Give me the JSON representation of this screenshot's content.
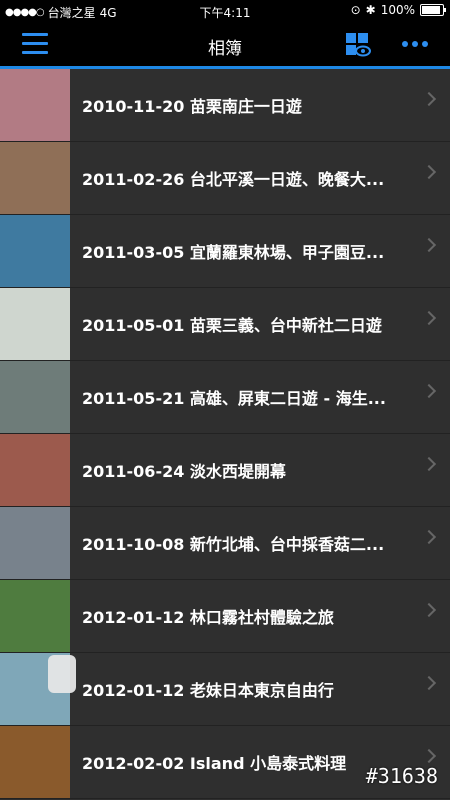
{
  "status": {
    "carrier": "台灣之星",
    "network": "4G",
    "time": "下午4:11",
    "battery": "100%",
    "battery_level": 1.0
  },
  "nav": {
    "title": "相簿"
  },
  "albums": [
    {
      "title": "2010-11-20 苗栗南庄一日遊",
      "thumb_color": "#b27b84"
    },
    {
      "title": "2011-02-26 台北平溪一日遊、晚餐大...",
      "thumb_color": "#8f6f57"
    },
    {
      "title": "2011-03-05 宜蘭羅東林場、甲子園豆...",
      "thumb_color": "#3f7aa0"
    },
    {
      "title": "2011-05-01 苗栗三義、台中新社二日遊",
      "thumb_color": "#cfd6cf"
    },
    {
      "title": "2011-05-21 高雄、屏東二日遊 - 海生...",
      "thumb_color": "#6e7c79"
    },
    {
      "title": "2011-06-24 淡水西堤開幕",
      "thumb_color": "#9c5a4d"
    },
    {
      "title": "2011-10-08 新竹北埔、台中採香菇二...",
      "thumb_color": "#78828c"
    },
    {
      "title": "2012-01-12 林口霧社村體驗之旅",
      "thumb_color": "#4f7c3f"
    },
    {
      "title": "2012-01-12 老妹日本東京自由行",
      "thumb_color": "#7fa7b8"
    },
    {
      "title": "2012-02-02 Island 小島泰式料理",
      "thumb_color": "#8a5a2c"
    }
  ],
  "watermark": "#31638"
}
